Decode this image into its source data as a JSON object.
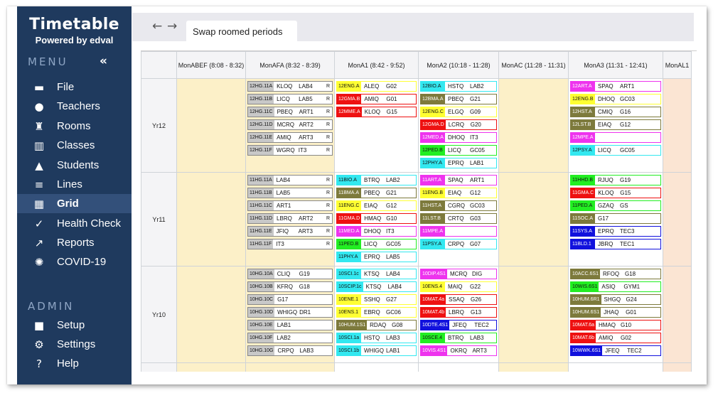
{
  "brand": {
    "title": "Timetable",
    "powered": "Powered by edval"
  },
  "menu": {
    "label": "MENU",
    "collapse": "«",
    "items": [
      {
        "icon": "file-icon",
        "glyph": "▬",
        "label": "File"
      },
      {
        "icon": "teachers-icon",
        "glyph": "●",
        "label": "Teachers"
      },
      {
        "icon": "rooms-icon",
        "glyph": "♜",
        "label": "Rooms"
      },
      {
        "icon": "classes-icon",
        "glyph": "▥",
        "label": "Classes"
      },
      {
        "icon": "students-icon",
        "glyph": "▲",
        "label": "Students"
      },
      {
        "icon": "lines-icon",
        "glyph": "≡",
        "label": "Lines"
      },
      {
        "icon": "grid-icon",
        "glyph": "▦",
        "label": "Grid",
        "active": true
      },
      {
        "icon": "health-check-icon",
        "glyph": "✓",
        "label": "Health Check"
      },
      {
        "icon": "reports-icon",
        "glyph": "↗",
        "label": "Reports"
      },
      {
        "icon": "covid-icon",
        "glyph": "✺",
        "label": "COVID-19"
      }
    ]
  },
  "admin": {
    "label": "ADMIN",
    "items": [
      {
        "icon": "lock-icon",
        "glyph": "■",
        "label": "Setup"
      },
      {
        "icon": "gear-icon",
        "glyph": "⚙",
        "label": "Settings"
      },
      {
        "icon": "help-icon",
        "glyph": "?",
        "label": "Help"
      }
    ]
  },
  "topbar": {
    "back": "←",
    "forward": "→",
    "tab": "Swap roomed periods"
  },
  "grid": {
    "columns": [
      "MonABEF (8:08 - 8:32)",
      "MonAFA (8:32 - 8:39)",
      "MonA1 (8:42 - 9:52)",
      "MonA2 (10:18 - 11:28)",
      "MonAC (11:28 - 11:31)",
      "MonA3 (11:31 - 12:41)",
      "MonAL1"
    ],
    "rows": [
      {
        "year": "Yr12",
        "cols": [
          [],
          [
            [
              "12HG.11A",
              "#c8c8c8",
              "KLOQ",
              "LAB4",
              "R"
            ],
            [
              "12HG.11B",
              "#c8c8c8",
              "LICQ",
              "LAB5",
              "R"
            ],
            [
              "12HG.11C",
              "#c8c8c8",
              "PBEQ",
              "ART1",
              "R"
            ],
            [
              "12HG.11D",
              "#c8c8c8",
              "MCRQ",
              "ART2",
              "R"
            ],
            [
              "12HG.11E",
              "#c8c8c8",
              "AMIQ",
              "ART3",
              "R"
            ],
            [
              "12HG.11F",
              "#c8c8c8",
              "WGRQ",
              "IT3",
              "R"
            ]
          ],
          [
            [
              "12ENG.A",
              "#ffff33",
              "ALEQ",
              "G02",
              ""
            ],
            [
              "12GMA.B",
              "#ee1111",
              "AMIQ",
              "G01",
              ""
            ],
            [
              "12MME.A",
              "#ee1111",
              "KLOQ",
              "G15",
              ""
            ]
          ],
          [
            [
              "12BIO.A",
              "#33e8f0",
              "HSTQ",
              "LAB2",
              ""
            ],
            [
              "12BMA.A",
              "#7d7a3c",
              "PBEQ",
              "G21",
              ""
            ],
            [
              "12ENG.C",
              "#ffff33",
              "ELGQ",
              "G09",
              ""
            ],
            [
              "12GMA.D",
              "#ee1111",
              "LCRQ",
              "G20",
              ""
            ],
            [
              "12MED.A",
              "#ee33ee",
              "DHOQ",
              "IT3",
              ""
            ],
            [
              "12PED.B",
              "#22ee22",
              "LICQ",
              "GC05",
              ""
            ],
            [
              "12PHY.A",
              "#33e8f0",
              "EPRQ",
              "LAB1",
              ""
            ]
          ],
          [],
          [
            [
              "12ART.A",
              "#ee33ee",
              "SPAQ",
              "ART1",
              ""
            ],
            [
              "12ENG.B",
              "#ffff33",
              "DHOQ",
              "GC03",
              ""
            ],
            [
              "12HST.A",
              "#7d7a3c",
              "CMIQ",
              "G16",
              ""
            ],
            [
              "12LST.B",
              "#7d7a3c",
              "EIAQ",
              "G12",
              ""
            ],
            [
              "12MPE.A",
              "#ee33ee",
              "",
              "",
              ""
            ],
            [
              "12PSY.A",
              "#33e8f0",
              "LICQ",
              "GC05",
              ""
            ]
          ],
          []
        ]
      },
      {
        "year": "Yr11",
        "cols": [
          [],
          [
            [
              "11HG.11A",
              "#c8c8c8",
              "LAB4",
              "",
              "R"
            ],
            [
              "11HG.11B",
              "#c8c8c8",
              "LAB5",
              "",
              "R"
            ],
            [
              "11HG.11C",
              "#c8c8c8",
              "ART1",
              "",
              "R"
            ],
            [
              "11HG.11D",
              "#c8c8c8",
              "LBRQ",
              "ART2",
              "R"
            ],
            [
              "11HG.11E",
              "#c8c8c8",
              "JFIQ",
              "ART3",
              "R"
            ],
            [
              "11HG.11F",
              "#c8c8c8",
              "IT3",
              "",
              "R"
            ]
          ],
          [
            [
              "11BIO.A",
              "#33e8f0",
              "BTRQ",
              "LAB2",
              ""
            ],
            [
              "11BMA.A",
              "#7d7a3c",
              "PBEQ",
              "G21",
              ""
            ],
            [
              "11ENG.C",
              "#ffff33",
              "EIAQ",
              "G12",
              ""
            ],
            [
              "11GMA.D",
              "#ee1111",
              "HMAQ",
              "G10",
              ""
            ],
            [
              "11MED.A",
              "#ee33ee",
              "DHOQ",
              "IT3",
              ""
            ],
            [
              "11PED.B",
              "#22ee22",
              "LICQ",
              "GC05",
              ""
            ],
            [
              "11PHY.A",
              "#33e8f0",
              "EPRQ",
              "LAB5",
              ""
            ]
          ],
          [
            [
              "11ART.A",
              "#ee33ee",
              "SPAQ",
              "ART1",
              ""
            ],
            [
              "11ENG.B",
              "#ffff33",
              "EIAQ",
              "G12",
              ""
            ],
            [
              "11HST.A",
              "#7d7a3c",
              "CGRQ",
              "GC03",
              ""
            ],
            [
              "11LST.B",
              "#7d7a3c",
              "CRTQ",
              "G03",
              ""
            ],
            [
              "11MPE.A",
              "#ee33ee",
              "",
              "",
              ""
            ],
            [
              "11PSY.A",
              "#33e8f0",
              "CRPQ",
              "G07",
              ""
            ]
          ],
          [],
          [
            [
              "11HHD.B",
              "#22ee22",
              "RJUQ",
              "G19",
              ""
            ],
            [
              "11GMA.C",
              "#ee1111",
              "KLOQ",
              "G15",
              ""
            ],
            [
              "11PED.A",
              "#22ee22",
              "GZAQ",
              "GS",
              ""
            ],
            [
              "11SOC.A",
              "#7d7a3c",
              "G17",
              "",
              ""
            ],
            [
              "11SYS.A",
              "#1111dd",
              "EPRQ",
              "TEC3",
              ""
            ],
            [
              "11BLD.1",
              "#1111dd",
              "JBRQ",
              "TEC1",
              ""
            ]
          ],
          []
        ]
      },
      {
        "year": "Yr10",
        "cols": [
          [],
          [
            [
              "10HG.10A",
              "#c8c8c8",
              "CLIQ",
              "G19",
              ""
            ],
            [
              "10HG.10B",
              "#c8c8c8",
              "KFRQ",
              "G18",
              ""
            ],
            [
              "10HG.10C",
              "#c8c8c8",
              "G17",
              "",
              ""
            ],
            [
              "10HG.10D",
              "#c8c8c8",
              "WHIGQ",
              "DR1",
              ""
            ],
            [
              "10HG.10E",
              "#c8c8c8",
              "LAB1",
              "",
              ""
            ],
            [
              "10HG.10F",
              "#c8c8c8",
              "LAB2",
              "",
              ""
            ],
            [
              "10HG.10G",
              "#c8c8c8",
              "CRPQ",
              "LAB3",
              ""
            ]
          ],
          [
            [
              "10SCI.1c",
              "#33e8f0",
              "KTSQ",
              "LAB4",
              ""
            ],
            [
              "10SCIP.1c",
              "#33e8f0",
              "KTSQ",
              "LAB4",
              ""
            ],
            [
              "10ENE.1",
              "#ffff33",
              "SSHQ",
              "G27",
              ""
            ],
            [
              "10ENS.1",
              "#ffff33",
              "EBRQ",
              "GC06",
              ""
            ],
            [
              "10HUM.1S1",
              "#7d7a3c",
              "RDAQ",
              "G08",
              ""
            ],
            [
              "10SCI.1a",
              "#33e8f0",
              "HSTQ",
              "LAB3",
              ""
            ],
            [
              "10SCI.1b",
              "#33e8f0",
              "WHIGQ",
              "LAB1",
              ""
            ]
          ],
          [
            [
              "10DIP.4S1",
              "#ee33ee",
              "MCRQ",
              "DIG",
              ""
            ],
            [
              "10ENS.4",
              "#ffff33",
              "MAIQ",
              "G22",
              ""
            ],
            [
              "10MAT.4a",
              "#ee1111",
              "SSAQ",
              "G26",
              ""
            ],
            [
              "10MAT.4b",
              "#ee1111",
              "LBRQ",
              "G13",
              ""
            ],
            [
              "10DTE.4S1",
              "#1111dd",
              "JFEQ",
              "TEC2",
              ""
            ],
            [
              "10SCE.4",
              "#22ee22",
              "BTRQ",
              "LAB3",
              ""
            ],
            [
              "10VIS.4S1",
              "#ee33ee",
              "OKRQ",
              "ART3",
              ""
            ]
          ],
          [],
          [
            [
              "10ACC.6S1",
              "#7d7a3c",
              "RFOQ",
              "G18",
              ""
            ],
            [
              "10WIS.6S1",
              "#22ee22",
              "ASIQ",
              "GYM1",
              ""
            ],
            [
              "10HUM.6R1",
              "#7d7a3c",
              "SHGQ",
              "G24",
              ""
            ],
            [
              "10HUM.6S1",
              "#7d7a3c",
              "JHAQ",
              "G01",
              ""
            ],
            [
              "10MAT.6a",
              "#ee1111",
              "HMAQ",
              "G10",
              ""
            ],
            [
              "10MAT.6b",
              "#ee1111",
              "AMIQ",
              "G02",
              ""
            ],
            [
              "10WWK.6S1",
              "#1111dd",
              "JFEQ",
              "TEC2",
              ""
            ]
          ],
          []
        ]
      },
      {
        "year": "",
        "cols": [
          [],
          [],
          [],
          [],
          [],
          [],
          []
        ]
      }
    ]
  }
}
